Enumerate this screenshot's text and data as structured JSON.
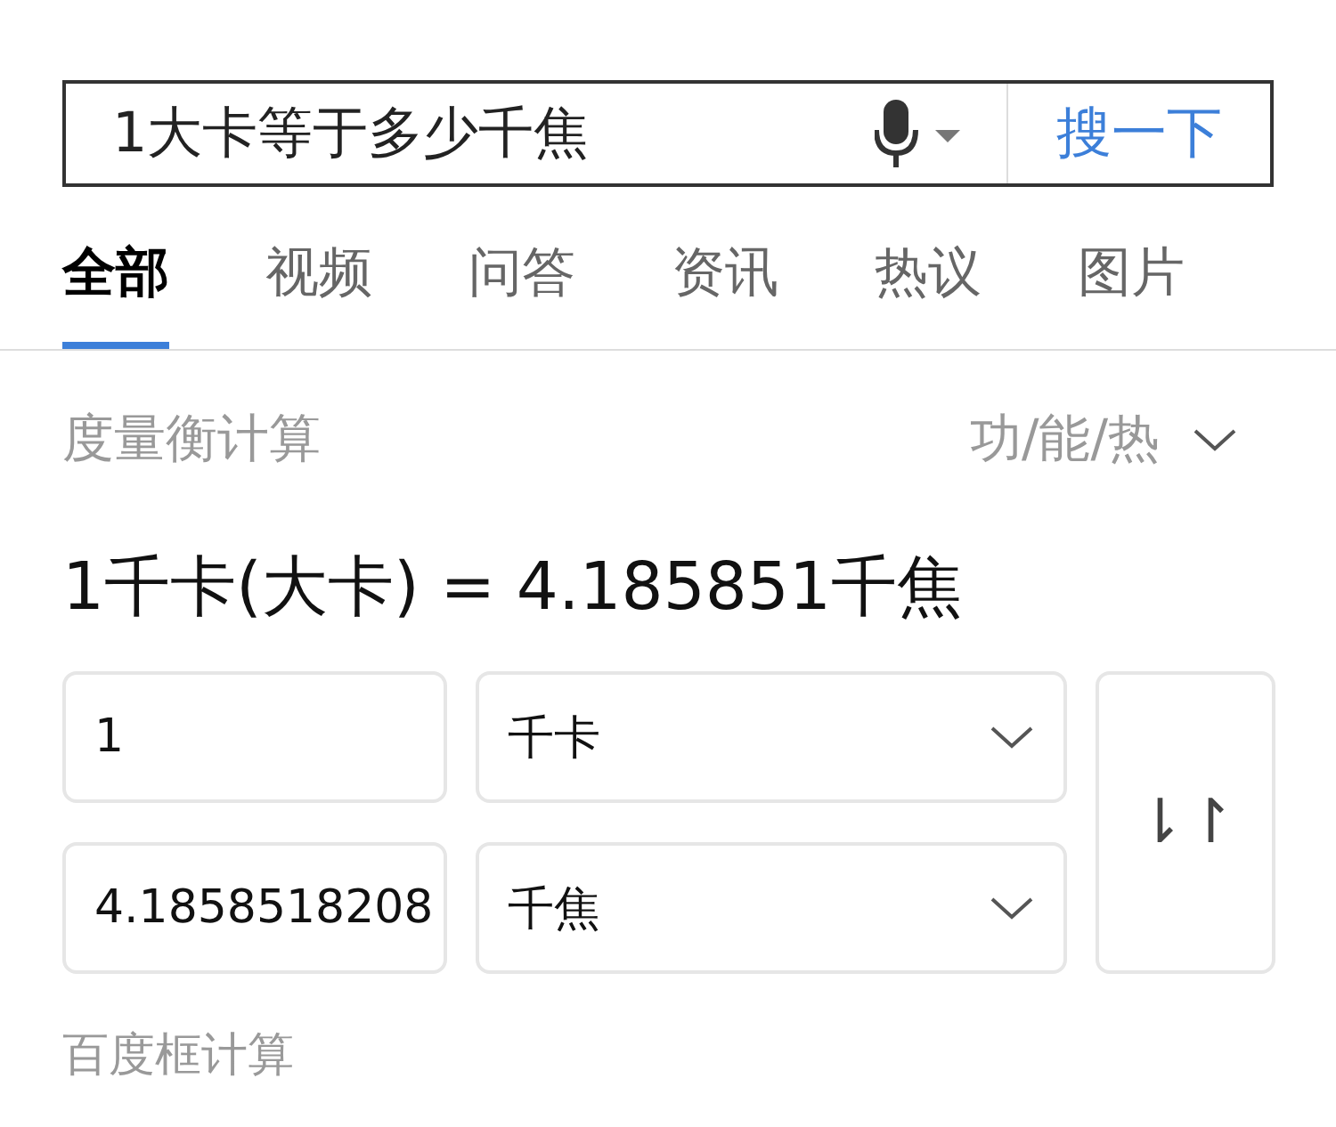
{
  "search": {
    "query": "1大卡等于多少千焦",
    "button": "搜一下"
  },
  "tabs": [
    {
      "label": "全部",
      "selected": true
    },
    {
      "label": "视频",
      "selected": false
    },
    {
      "label": "问答",
      "selected": false
    },
    {
      "label": "资讯",
      "selected": false
    },
    {
      "label": "热议",
      "selected": false
    },
    {
      "label": "图片",
      "selected": false
    }
  ],
  "converter": {
    "title": "度量衡计算",
    "category": "功/能/热",
    "result": "1千卡(大卡) = 4.185851千焦",
    "rows": [
      {
        "value": "1",
        "unit": "千卡"
      },
      {
        "value": "4.1858518208",
        "unit": "千焦"
      }
    ],
    "swap": "⇂↾",
    "footer": "百度框计算"
  }
}
